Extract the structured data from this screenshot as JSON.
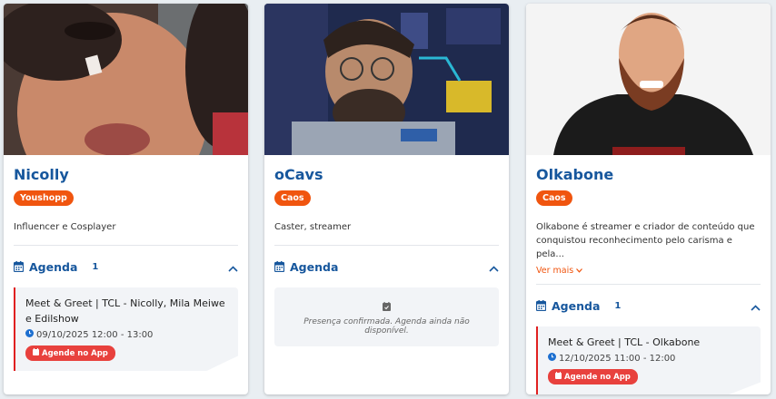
{
  "cards": [
    {
      "name": "Nicolly",
      "team": "Youshopp",
      "bio": "Influencer e Cosplayer",
      "agenda_label": "Agenda",
      "agenda_count": "1",
      "event_title": "Meet & Greet | TCL - Nicolly, Mila Meiwe e Edilshow",
      "event_time": "09/10/2025 12:00 - 13:00",
      "app_button": "Agende no App"
    },
    {
      "name": "oCavs",
      "team": "Caos",
      "bio": "Caster, streamer",
      "agenda_label": "Agenda",
      "empty_text": "Presença confirmada. Agenda ainda não disponível."
    },
    {
      "name": "Olkabone",
      "team": "Caos",
      "bio": "Olkabone é streamer e criador de conteúdo que conquistou reconhecimento pelo carisma e pela...",
      "see_more": "Ver mais",
      "agenda_label": "Agenda",
      "agenda_count": "1",
      "event_title": "Meet & Greet | TCL - Olkabone",
      "event_time": "12/10/2025 11:00 - 12:00",
      "app_button": "Agende no App"
    }
  ],
  "colors": {
    "brand_blue": "#17579d",
    "badge_orange": "#f0550f",
    "accent_red": "#e02020"
  },
  "icons": [
    "calendar-icon",
    "chevron-up-icon",
    "clock-icon",
    "calendar-small-icon",
    "chevron-down-icon"
  ]
}
